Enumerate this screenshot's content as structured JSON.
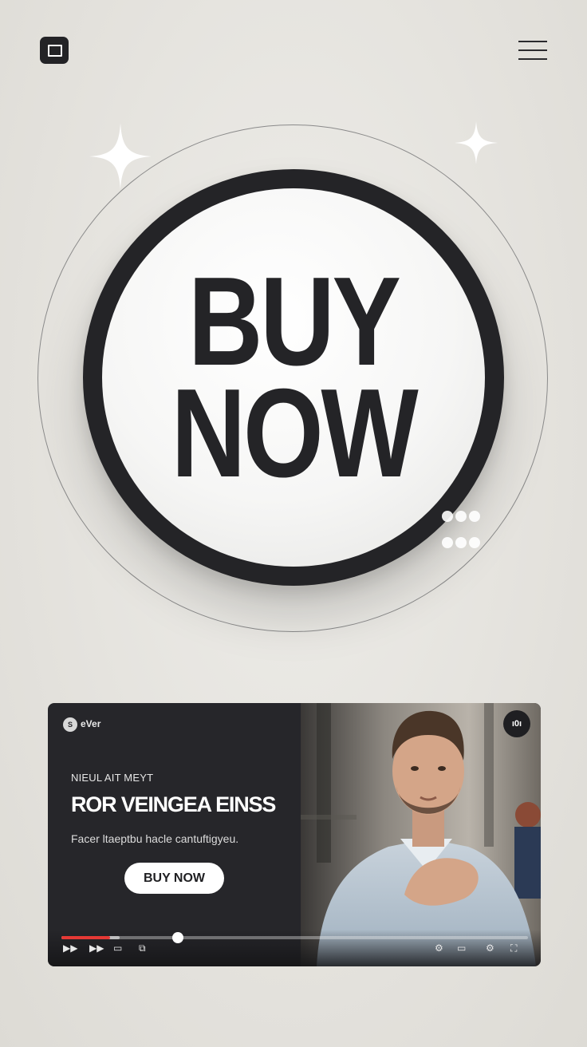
{
  "hero": {
    "line1": "BUY",
    "line2": "NOW"
  },
  "video": {
    "channel_logo": "S",
    "channel_name": "eVer",
    "eyebrow": "NIEUL AIT MEYT",
    "headline": "ROR VEINGEA EINSS",
    "subtext": "Facer ltaeptbu hacle cantuftigyeu.",
    "cta_label": "BUY NOW",
    "corner_badge": "ı0ı",
    "progress": {
      "watched": 0.105,
      "buffered": 0.125,
      "playhead": 0.249
    },
    "controls": {
      "play": "▶▶",
      "next": "▶▶",
      "captions": "▭",
      "miniplayer": "⧉",
      "settings": "⚙",
      "theater": "▭",
      "quality": "⚙",
      "fullscreen": "⛶"
    }
  },
  "colors": {
    "background": "#e4e2dd",
    "ink": "#242427",
    "progress_red": "#e53935"
  },
  "icons": [
    "app-square-icon",
    "hamburger-menu-icon",
    "sparkle-icon",
    "dots-grid-icon"
  ]
}
